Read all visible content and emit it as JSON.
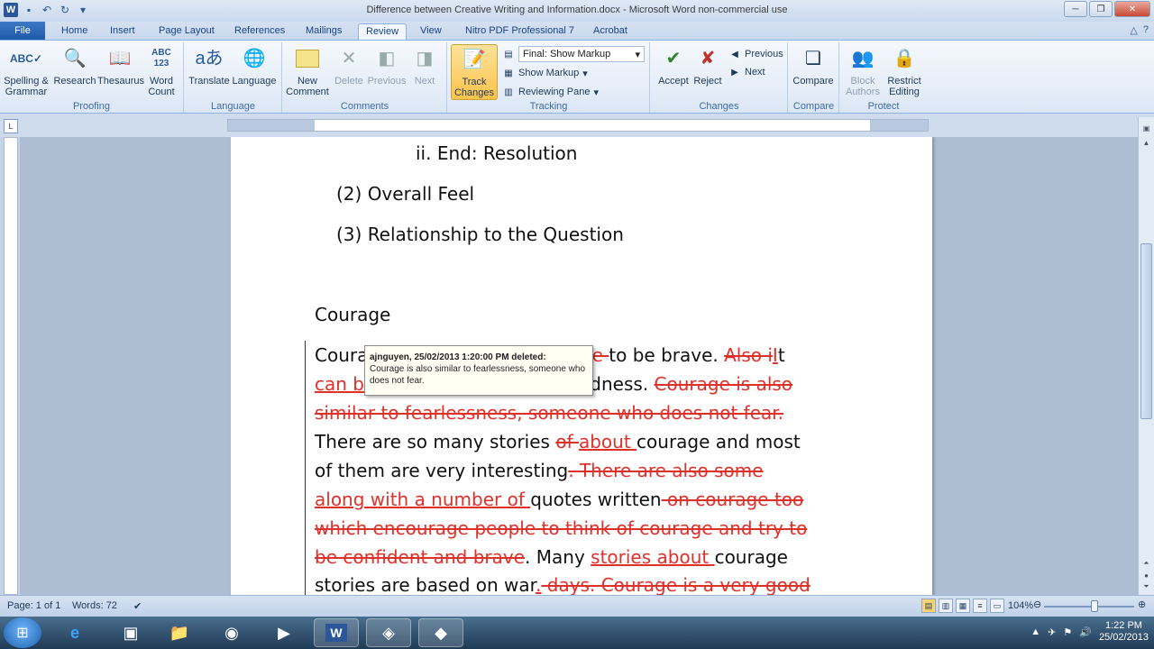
{
  "window": {
    "title": "Difference between Creative Writing and Information.docx - Microsoft Word non-commercial use"
  },
  "tabs": [
    "File",
    "Home",
    "Insert",
    "Page Layout",
    "References",
    "Mailings",
    "Review",
    "View",
    "Nitro PDF Professional 7",
    "Acrobat"
  ],
  "active_tab": "Review",
  "ribbon": {
    "proofing": {
      "label": "Proofing",
      "spelling": "Spelling & Grammar",
      "research": "Research",
      "thesaurus": "Thesaurus",
      "wordcount": "Word Count"
    },
    "language": {
      "label": "Language",
      "translate": "Translate",
      "language": "Language"
    },
    "comments": {
      "label": "Comments",
      "new": "New Comment",
      "delete": "Delete",
      "previous": "Previous",
      "next": "Next"
    },
    "tracking": {
      "label": "Tracking",
      "track": "Track Changes",
      "final": "Final: Show Markup",
      "show_markup": "Show Markup",
      "reviewing_pane": "Reviewing Pane"
    },
    "changes": {
      "label": "Changes",
      "accept": "Accept",
      "reject": "Reject",
      "previous": "Previous",
      "next": "Next"
    },
    "compare": {
      "label": "Compare",
      "compare": "Compare"
    },
    "protect": {
      "label": "Protect",
      "block": "Block Authors",
      "restrict": "Restrict Editing"
    }
  },
  "document": {
    "outline1": "ii.  End: Resolution",
    "outline2": "(2)   Overall Feel",
    "outline3": "(3)   Relationship to the Question",
    "heading": "Courage",
    "p1a": "Courag",
    "p1_del1": "le ",
    "p1b": "to be brave. ",
    "p1_del2": "Also i",
    "p1_ins1": "I",
    "p1c": "t",
    "p2_ins": "can be",
    "p2b": "dness. ",
    "p2_del": "Courage is also",
    "p3_del": "similar to fearlessness, someone who does not fear.",
    "p4a": "There are so many stories ",
    "p4_del": "of ",
    "p4_ins": "about ",
    "p4b": "courage and most",
    "p5a": "of them are very interesting",
    "p5_del": ". There are also some",
    "p6_ins": "along with a number of ",
    "p6a": "quotes written",
    "p6_del": " on courage too",
    "p7_del": "which encourage people to think of courage and try to",
    "p8_del": "be confident and brave",
    "p8a": ". Many ",
    "p8_ins": "stories about ",
    "p8b": "courage",
    "p9a": "stories are based on war",
    "p9_ins": ".",
    "p9_del": " days. Courage is a very good"
  },
  "tooltip": {
    "header": "ajnguyen, 25/02/2013 1:20:00 PM deleted:",
    "body": "Courage is also similar to fearlessness, someone who does not fear."
  },
  "status": {
    "page": "Page: 1 of 1",
    "words": "Words: 72",
    "zoom": "104%"
  },
  "taskbar": {
    "time": "1:22 PM",
    "date": "25/02/2013"
  },
  "colors": {
    "markup": "#e0302a",
    "tracking_active": "#fbc34b"
  }
}
